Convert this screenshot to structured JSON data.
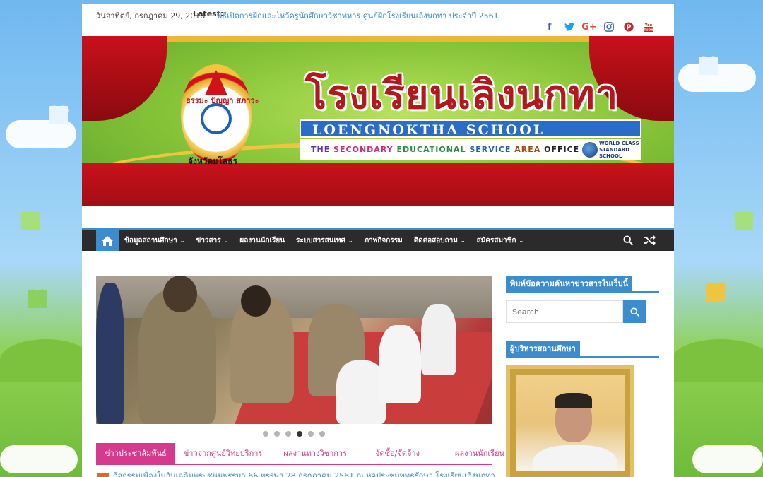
{
  "topbar": {
    "date": "วันอาทิตย์, กรกฎาคม 29, 2018",
    "latest_label": "Latest:",
    "latest_link": "พิธีเปิดการฝึกและไหว้ครูนักศึกษาวิชาทหาร ศูนย์ฝึกโรงเรียนเลิงนกทา ประจำปี 2561",
    "social": [
      {
        "icon": "facebook-icon",
        "glyph": "f",
        "color": "#3b5998"
      },
      {
        "icon": "twitter-icon",
        "glyph": "t",
        "color": "#1da1f2"
      },
      {
        "icon": "google-plus-icon",
        "glyph": "G+",
        "color": "#dd4b39"
      },
      {
        "icon": "instagram-icon",
        "glyph": "◎",
        "color": "#3f729b"
      },
      {
        "icon": "pinterest-icon",
        "glyph": "P",
        "color": "#cb2027"
      },
      {
        "icon": "youtube-icon",
        "glyph": "▶",
        "color": "#cd201f"
      }
    ]
  },
  "banner": {
    "title": "โรงเรียนเลิงนกทา",
    "title_en": "LOENGNOKTHA SCHOOL",
    "office": [
      "THE",
      "SECONDARY",
      "EDUCATIONAL",
      "SERVICE",
      "AREA",
      "OFFICE 28"
    ],
    "world_class": "WORLD CLASS STANDARD SCHOOL",
    "emblem_top": "ธรรมะ ปัญญา สภาวะ",
    "emblem_bottom": "จังหวัดยโสธร"
  },
  "nav": {
    "items": [
      {
        "label": "ข้อมูลสถานศึกษา",
        "dropdown": true
      },
      {
        "label": "ข่าวสาร",
        "dropdown": true
      },
      {
        "label": "ผลงานนักเรียน",
        "dropdown": false
      },
      {
        "label": "ระบบสารสนเทศ",
        "dropdown": true
      },
      {
        "label": "ภาพกิจกรรม",
        "dropdown": false
      },
      {
        "label": "ติดต่อสอบถาม",
        "dropdown": true
      },
      {
        "label": "สมัครสมาชิก",
        "dropdown": true
      }
    ],
    "caret": "⌄"
  },
  "slider": {
    "dots": 6,
    "active_index": 3
  },
  "tabs": {
    "items": [
      "ข่าวประชาสัมพันธ์",
      "ข่าวจากศูนย์วิทยบริการ",
      "ผลงานทางวิชาการ",
      "จัดซื้อ/จัดจ้าง",
      "ผลงานนักเรียน"
    ],
    "active_index": 0
  },
  "news": {
    "first_item": "กิจกรรมเนื่องในวันเฉลิมพระชนมพรรษา 66 พรรษา 28 กรกฎาคม 2561 ณ หอประชุมพุทธรักษา โรงเรียนเลิงนกทา"
  },
  "sidebar": {
    "search_title": "พิมพ์ข้อความค้นหาข่าวสารในเว็บนี้",
    "search_placeholder": "Search",
    "director_title": "ผู้บริหารสถานศึกษา"
  },
  "colors": {
    "accent": "#3c8dce",
    "nav_bg": "#2b2b2b",
    "tab_accent": "#d63a8e"
  }
}
